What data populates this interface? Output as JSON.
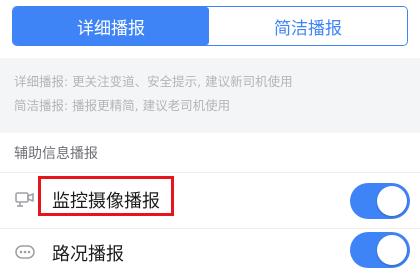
{
  "mode_tabs": {
    "detailed_label": "详细播报",
    "concise_label": "简洁播报",
    "selected": "detailed"
  },
  "descriptions": {
    "detailed": "详细播报: 更关注变道、安全提示, 建议新司机使用",
    "concise": "简洁播报: 播报更精简, 建议老司机使用"
  },
  "aux_section": {
    "title": "辅助信息播报",
    "items": [
      {
        "label": "监控摄像播报",
        "icon": "camera-icon",
        "enabled": true,
        "highlighted": true
      },
      {
        "label": "路况播报",
        "icon": "traffic-bubble-icon",
        "enabled": true,
        "highlighted": false
      }
    ]
  },
  "colors": {
    "accent": "#3f84f7",
    "highlight": "#e8141c"
  }
}
